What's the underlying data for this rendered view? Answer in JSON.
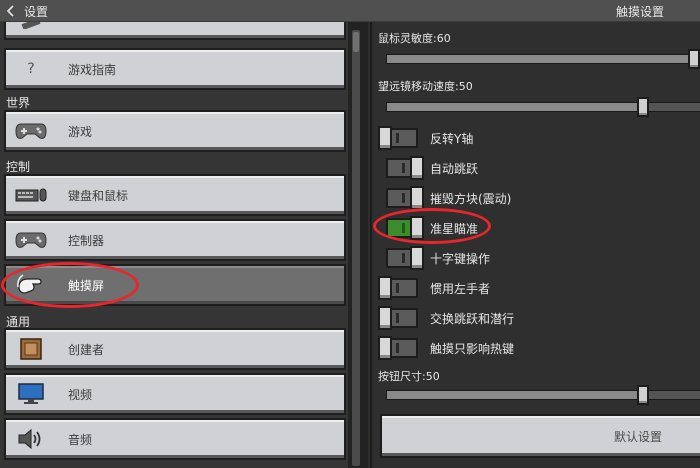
{
  "header": {
    "back_label": "设置",
    "title": "触摸设置"
  },
  "sidebar": {
    "partial_item_label": "",
    "items": [
      {
        "label": "游戏指南",
        "icon": "question-mark-icon"
      },
      {
        "label": "游戏",
        "icon": "gamepad-icon"
      },
      {
        "label": "键盘和鼠标",
        "icon": "keyboard-mouse-icon"
      },
      {
        "label": "控制器",
        "icon": "gamepad-icon"
      },
      {
        "label": "触摸屏",
        "icon": "touch-hand-icon",
        "selected": true
      },
      {
        "label": "创建者",
        "icon": "creator-block-icon"
      },
      {
        "label": "视频",
        "icon": "monitor-icon"
      },
      {
        "label": "音频",
        "icon": "speaker-icon"
      }
    ],
    "categories": {
      "world": "世界",
      "controls": "控制",
      "general": "通用"
    }
  },
  "settings": {
    "mouse_sensitivity": {
      "label": "鼠标灵敏度:60",
      "value": 60,
      "max": 100
    },
    "spyglass_speed": {
      "label": "望远镜移动速度:50",
      "value": 50,
      "max": 100
    },
    "toggles": [
      {
        "label": "反转Y轴",
        "on": false
      },
      {
        "label": "自动跳跃",
        "on": false
      },
      {
        "label": "摧毁方块(震动)",
        "on": false
      },
      {
        "label": "准星瞄准",
        "on": true
      },
      {
        "label": "十字键操作",
        "on": false
      },
      {
        "label": "惯用左手者",
        "on": false
      },
      {
        "label": "交换跳跃和潜行",
        "on": false
      },
      {
        "label": "触摸只影响热键",
        "on": false
      }
    ],
    "button_size": {
      "label": "按钮尺寸:50",
      "value": 50,
      "max": 100
    },
    "default_button": "默认设置"
  },
  "colors": {
    "annotation": "#e8262c",
    "toggle_on": "#3c8c2e"
  }
}
